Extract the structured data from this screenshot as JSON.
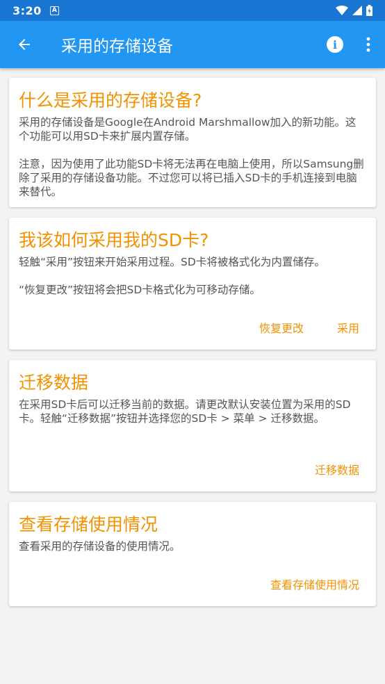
{
  "status": {
    "time": "3:20",
    "notif_letter": "A"
  },
  "appbar": {
    "title": "采用的存储设备"
  },
  "cards": [
    {
      "title": "什么是采用的存储设备?",
      "paragraphs": [
        "采用的存储设备是Google在Android Marshmallow加入的新功能。这个功能可以用SD卡来扩展内置存储。",
        "注意，因为使用了此功能SD卡将无法再在电脑上使用，所以Samsung删除了采用的存储设备功能。不过您可以将已插入SD卡的手机连接到电脑来替代。"
      ]
    },
    {
      "title": "我该如何采用我的SD卡?",
      "paragraphs": [
        "轻触“采用”按钮来开始采用过程。SD卡将被格式化为内置储存。",
        "“恢复更改”按钮将会把SD卡格式化为可移动存储。"
      ],
      "buttons": [
        "恢复更改",
        "采用"
      ]
    },
    {
      "title": "迁移数据",
      "paragraphs": [
        "在采用SD卡后可以迁移当前的数据。请更改默认安装位置为采用的SD卡。轻触“迁移数据”按钮并选择您的SD卡 > 菜单 > 迁移数据。"
      ],
      "buttons": [
        "迁移数据"
      ]
    },
    {
      "title": "查看存储使用情况",
      "paragraphs": [
        "查看采用的存储设备的使用情况。"
      ],
      "buttons": [
        "查看存储使用情况"
      ]
    }
  ],
  "colors": {
    "statusbar": "#1976d2",
    "appbar": "#2196f3",
    "accent": "#f39200"
  }
}
